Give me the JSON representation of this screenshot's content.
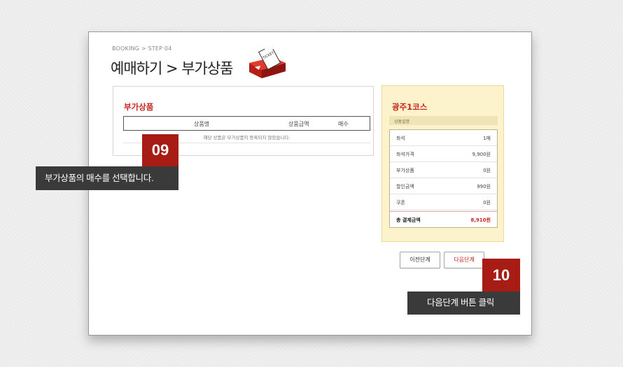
{
  "breadcrumb": "BOOKING > STEP 04",
  "page_title": "예매하기 > 부가상품",
  "ticket_text": "TICKET",
  "addons": {
    "title": "부가상품",
    "columns": [
      "상품명",
      "상품금액",
      "매수"
    ],
    "empty_message": "해당 상품은 부가상품이 등록되지 않았습니다."
  },
  "summary": {
    "course": "광주1코스",
    "desc_label": "상품설명",
    "rows": [
      {
        "label": "좌석",
        "value": "1매"
      },
      {
        "label": "좌석가격",
        "value": "9,900원"
      },
      {
        "label": "부가상품",
        "value": "0원"
      },
      {
        "label": "할인금액",
        "value": "990원"
      },
      {
        "label": "쿠폰",
        "value": "0원"
      }
    ],
    "total": {
      "label": "총 결제금액",
      "value": "8,910원"
    }
  },
  "buttons": {
    "prev": "이전단계",
    "next": "다음단계"
  },
  "steps": [
    {
      "number": "09",
      "text": "부가상품의 매수를 선택합니다."
    },
    {
      "number": "10",
      "text": "다음단계 버튼 클릭"
    }
  ],
  "colors": {
    "accent": "#c8261f",
    "badge": "#a71d16",
    "callout": "#3a3a3a",
    "summary_bg": "#fcf3cc"
  }
}
